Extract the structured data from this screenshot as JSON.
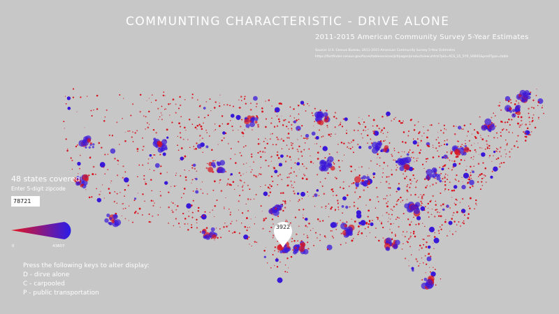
{
  "header": {
    "title": "COMMUNTING CHARACTERISTIC - DRIVE ALONE",
    "subtitle": "2011-2015 American Community Survey 5-Year Estimates",
    "source_line": "Source: U.S. Census Bureau, 2011-2015 American Community Survey 5-Year Estimates",
    "url_line": "https://factfinder.census.gov/faces/tableservices/jsf/pages/productview.xhtml?pid=ACS_15_5YR_S0801&prodType=table"
  },
  "controls": {
    "states_covered": "48 states covered",
    "zip_label": "Enter 5-digit zipcode",
    "zip_value": "78721"
  },
  "legend": {
    "min_label": "0",
    "max_label": "43807",
    "low_color": "#e8141c",
    "high_color": "#2a1de8"
  },
  "instructions": {
    "heading": "Press the following keys to alter display:",
    "key_d": "D - dirve alone",
    "key_c": "C - carpooled",
    "key_p": "P - public transportation"
  },
  "marker": {
    "value": "3922"
  },
  "colors": {
    "background": "#c7c7c7",
    "dot_red": "#d8141e",
    "dot_blue": "#3a18d8"
  }
}
